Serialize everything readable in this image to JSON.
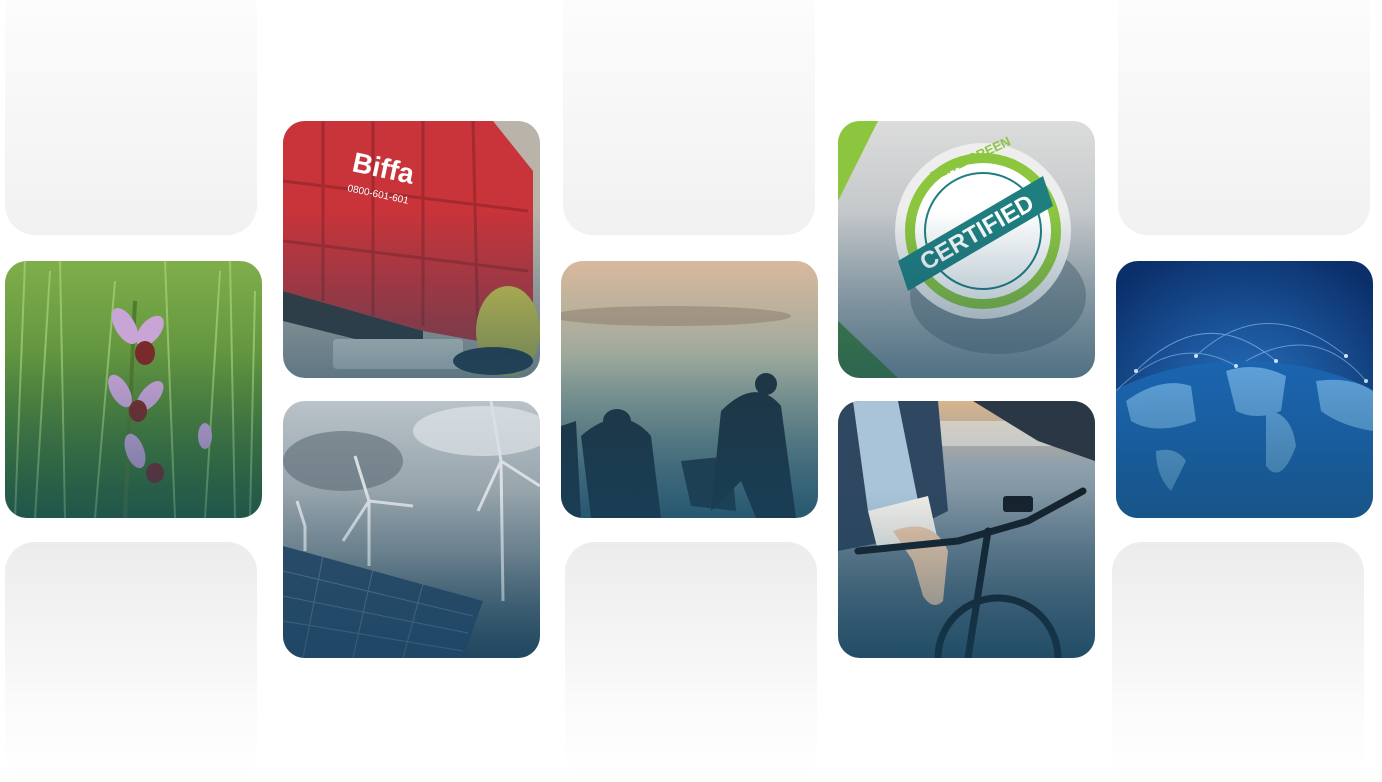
{
  "gallery": {
    "photos": {
      "orchid": {
        "icon": "bee-orchid-meadow-photo"
      },
      "skip": {
        "brand": "Biffa",
        "phone": "0800-601-601",
        "icon": "red-skip-bin-photo"
      },
      "wind": {
        "icon": "wind-turbines-solar-panels-photo"
      },
      "litter": {
        "icon": "litter-pickers-silhouette-photo"
      },
      "badge": {
        "line1": "ELITE GREEN",
        "line2": "CERTIFIED",
        "icon": "certified-badge-photo"
      },
      "bike": {
        "icon": "businessman-bicycle-photo"
      },
      "globe": {
        "icon": "digital-globe-network-photo"
      }
    },
    "colors": {
      "placeholder": "#f3f3f3",
      "overlay": "#1c5070",
      "skip_red": "#c8343a",
      "badge_green": "#8cc63f",
      "badge_teal": "#1f7f80",
      "globe_blue": "#0e4f9e"
    }
  }
}
